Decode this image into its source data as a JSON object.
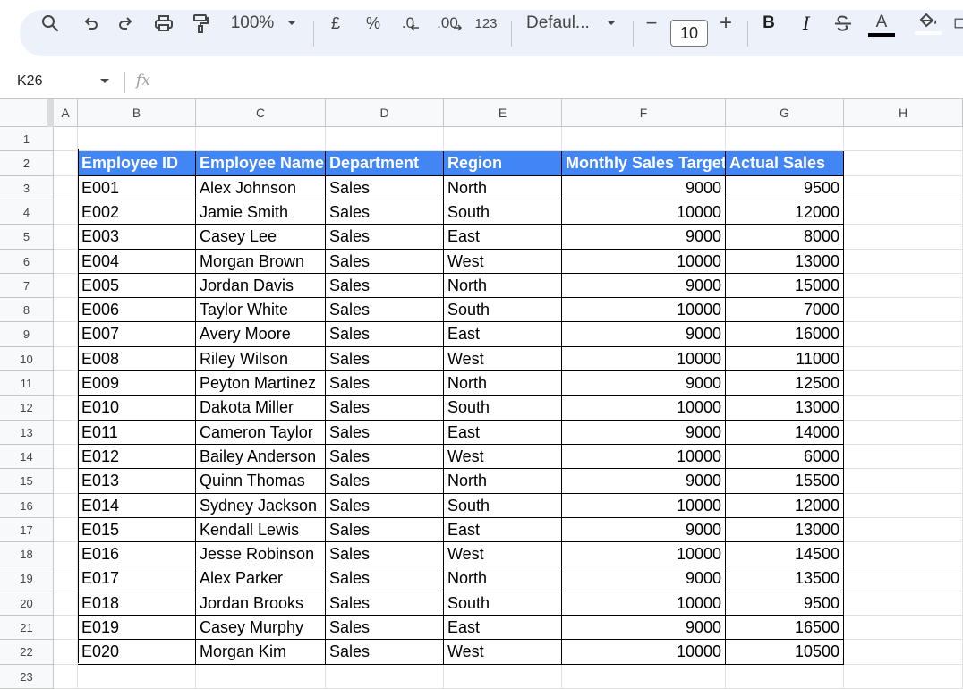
{
  "toolbar": {
    "zoom": "100%",
    "currency": "£",
    "percent": "%",
    "decrease_decimals": ".0",
    "increase_decimals": ".00",
    "number_format": "123",
    "font": "Defaul...",
    "font_size": "10",
    "minus": "−",
    "plus": "+",
    "bold": "B",
    "italic": "I",
    "text_color": "A"
  },
  "formula_bar": {
    "cell_ref": "K26",
    "fx": "fx",
    "value": ""
  },
  "columns": [
    "A",
    "B",
    "C",
    "D",
    "E",
    "F",
    "G",
    "H"
  ],
  "rows": [
    "1",
    "2",
    "3",
    "4",
    "5",
    "6",
    "7",
    "8",
    "9",
    "10",
    "11",
    "12",
    "13",
    "14",
    "15",
    "16",
    "17",
    "18",
    "19",
    "20",
    "21",
    "22",
    "23"
  ],
  "table": {
    "header": [
      "Employee ID",
      "Employee Name",
      "Department",
      "Region",
      "Monthly Sales Target",
      "Actual Sales"
    ],
    "header_color": "#4285f4",
    "records": [
      [
        "E001",
        "Alex Johnson",
        "Sales",
        "North",
        "9000",
        "9500"
      ],
      [
        "E002",
        "Jamie Smith",
        "Sales",
        "South",
        "10000",
        "12000"
      ],
      [
        "E003",
        "Casey Lee",
        "Sales",
        "East",
        "9000",
        "8000"
      ],
      [
        "E004",
        "Morgan Brown",
        "Sales",
        "West",
        "10000",
        "13000"
      ],
      [
        "E005",
        "Jordan Davis",
        "Sales",
        "North",
        "9000",
        "15000"
      ],
      [
        "E006",
        "Taylor White",
        "Sales",
        "South",
        "10000",
        "7000"
      ],
      [
        "E007",
        "Avery Moore",
        "Sales",
        "East",
        "9000",
        "16000"
      ],
      [
        "E008",
        "Riley Wilson",
        "Sales",
        "West",
        "10000",
        "11000"
      ],
      [
        "E009",
        "Peyton Martinez",
        "Sales",
        "North",
        "9000",
        "12500"
      ],
      [
        "E010",
        "Dakota Miller",
        "Sales",
        "South",
        "10000",
        "13000"
      ],
      [
        "E011",
        "Cameron Taylor",
        "Sales",
        "East",
        "9000",
        "14000"
      ],
      [
        "E012",
        "Bailey Anderson",
        "Sales",
        "West",
        "10000",
        "6000"
      ],
      [
        "E013",
        "Quinn Thomas",
        "Sales",
        "North",
        "9000",
        "15500"
      ],
      [
        "E014",
        "Sydney Jackson",
        "Sales",
        "South",
        "10000",
        "12000"
      ],
      [
        "E015",
        "Kendall Lewis",
        "Sales",
        "East",
        "9000",
        "13000"
      ],
      [
        "E016",
        "Jesse Robinson",
        "Sales",
        "West",
        "10000",
        "14500"
      ],
      [
        "E017",
        "Alex Parker",
        "Sales",
        "North",
        "9000",
        "13500"
      ],
      [
        "E018",
        "Jordan Brooks",
        "Sales",
        "South",
        "10000",
        "9500"
      ],
      [
        "E019",
        "Casey Murphy",
        "Sales",
        "East",
        "9000",
        "16500"
      ],
      [
        "E020",
        "Morgan Kim",
        "Sales",
        "West",
        "10000",
        "10500"
      ]
    ]
  }
}
